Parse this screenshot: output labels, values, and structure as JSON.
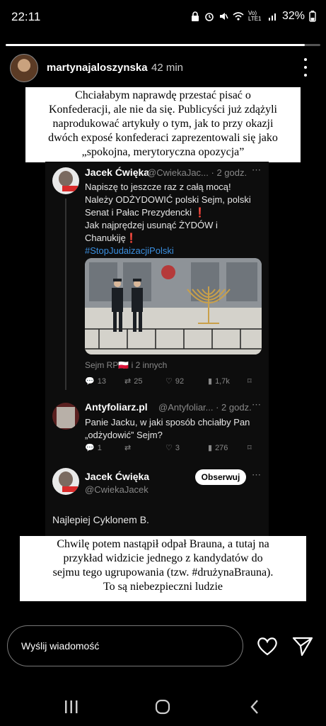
{
  "status_bar": {
    "time": "22:11",
    "network": "Vo) LTE1",
    "battery": "32%"
  },
  "story": {
    "progress": 0.95
  },
  "header": {
    "username": "martynajaloszynska",
    "time_ago": "42 min"
  },
  "caption_top": [
    "Chciałabym naprawdę przestać pisać o",
    "Konfederacji, ale nie da się. Publicyści już zdążyli",
    "naprodukować artykuły o tym, jak to przy okazji",
    "dwóch exposé konfederaci zaprezentowali się jako",
    "„spokojna, merytoryczna opozycja”"
  ],
  "tweet1": {
    "name": "Jacek Ćwięka",
    "handle": "@CwiekaJac... · 2 godz.",
    "lines": [
      "Napiszę to jeszcze raz z całą mocą!",
      "Należy ODŻYDOWIĆ polski Sejm, polski",
      "Senat i Pałac Prezydencki",
      "Jak najprędzej usunąć ŻYDÓW i",
      "Chanukiję"
    ],
    "hashtag": "#StopJudaizacjiPolski",
    "tagged": "Sejm RP🇵🇱 i 2 innych",
    "replies": "13",
    "retweets": "25",
    "likes": "92",
    "views": "1,7k"
  },
  "tweet2": {
    "name": "Antyfoliarz.pl",
    "handle": "@Antyfoliar... · 2 godz.",
    "lines": [
      "Panie Jacku, w jaki sposób chciałby Pan",
      "„odżydowić” Sejm?"
    ],
    "replies": "1",
    "likes": "3",
    "views": "276"
  },
  "tweet3": {
    "name": "Jacek Ćwięka",
    "handle": "@CwiekaJacek",
    "follow": "Obserwuj",
    "text": "Najlepiej Cyklonem B."
  },
  "caption_bottom": [
    "Chwilę potem nastąpił odpał Brauna, a tutaj na",
    "przykład widzicie jednego z kandydatów do",
    "sejmu tego ugrupowania (tzw. #drużynaBrauna).",
    "To są niebezpieczni ludzie"
  ],
  "message": {
    "placeholder": "Wyślij wiadomość"
  },
  "icons": [
    "heart-icon",
    "send-icon",
    "more-icon",
    "recent-apps-icon",
    "home-icon",
    "back-icon"
  ]
}
